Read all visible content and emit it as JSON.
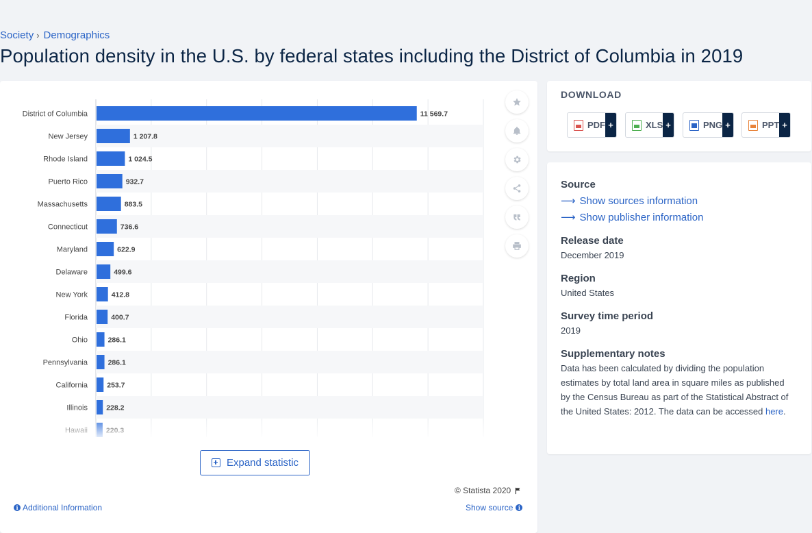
{
  "breadcrumb": [
    {
      "label": "Society"
    },
    {
      "label": "Demographics"
    }
  ],
  "title": "Population density in the U.S. by federal states including the District of Columbia in 2019",
  "chart_data": {
    "type": "bar",
    "orientation": "horizontal",
    "categories": [
      "District of Columbia",
      "New Jersey",
      "Rhode Island",
      "Puerto Rico",
      "Massachusetts",
      "Connecticut",
      "Maryland",
      "Delaware",
      "New York",
      "Florida",
      "Ohio",
      "Pennsylvania",
      "California",
      "Illinois",
      "Hawaii"
    ],
    "values": [
      11569.7,
      1207.8,
      1024.5,
      932.7,
      883.5,
      736.6,
      622.9,
      499.6,
      412.8,
      400.7,
      286.1,
      286.1,
      253.7,
      228.2,
      220.3
    ],
    "value_labels": [
      "11 569.7",
      "1 207.8",
      "1 024.5",
      "932.7",
      "883.5",
      "736.6",
      "622.9",
      "499.6",
      "412.8",
      "400.7",
      "286.1",
      "286.1",
      "253.7",
      "228.2",
      "220.3"
    ],
    "xlim": [
      0,
      14000
    ],
    "grid": true,
    "bar_color": "#2f6fdc"
  },
  "toolbar": [
    "star-icon",
    "bell-icon",
    "gear-icon",
    "share-icon",
    "quote-icon",
    "print-icon"
  ],
  "expand_label": "Expand statistic",
  "copyright": "© Statista 2020",
  "additional_info": "Additional Information",
  "show_source": "Show source",
  "download": {
    "title": "DOWNLOAD",
    "buttons": [
      {
        "label": "PDF",
        "plus": "+",
        "color": "#d9534f"
      },
      {
        "label": "XLS",
        "plus": "+",
        "color": "#4caf50"
      },
      {
        "label": "PNG",
        "plus": "+",
        "color": "#2b64c6"
      },
      {
        "label": "PPT",
        "plus": "+",
        "color": "#e8833a"
      }
    ]
  },
  "meta": {
    "source_heading": "Source",
    "show_sources": "Show sources information",
    "show_publisher": "Show publisher information",
    "release_heading": "Release date",
    "release_value": "December 2019",
    "region_heading": "Region",
    "region_value": "United States",
    "survey_heading": "Survey time period",
    "survey_value": "2019",
    "notes_heading": "Supplementary notes",
    "notes_text": "Data has been calculated by dividing the population estimates by total land area in square miles as published by the Census Bureau as part of the Statistical Abstract of the United States: 2012. The data can be accessed ",
    "notes_link": "here",
    "notes_end": "."
  }
}
